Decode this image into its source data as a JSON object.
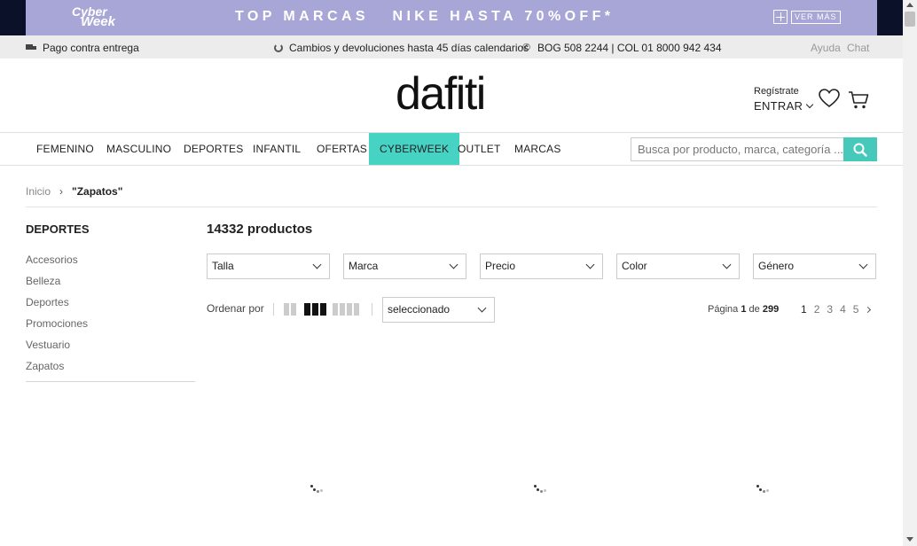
{
  "promo": {
    "logo_line1": "Cyber",
    "logo_line2": "Week",
    "text": "TOP MARCAS   NIKE HASTA 70%OFF*",
    "cta": "VER MÁS"
  },
  "utility": {
    "delivery": "Pago contra entrega",
    "returns": "Cambios y devoluciones hasta 45 días calendarios",
    "phones": "BOG 508 2244 | COL 01 8000 942 434",
    "help": "Ayuda",
    "chat": "Chat"
  },
  "header": {
    "logo": "dafiti",
    "register": "Regístrate",
    "login": "ENTRAR"
  },
  "nav": {
    "items": [
      "FEMENINO",
      "MASCULINO",
      "DEPORTES",
      "INFANTIL",
      "OFERTAS",
      "CYBERWEEK",
      "OUTLET",
      "MARCAS"
    ],
    "active": "CYBERWEEK",
    "search_placeholder": "Busca por producto, marca, categoría ..."
  },
  "breadcrumb": {
    "home": "Inicio",
    "separator": "›",
    "current": "\"Zapatos\""
  },
  "sidebar": {
    "title": "DEPORTES",
    "items": [
      "Accesorios",
      "Belleza",
      "Deportes",
      "Promociones",
      "Vestuario",
      "Zapatos"
    ]
  },
  "results": {
    "count": "14332 productos",
    "filters": [
      "Talla",
      "Marca",
      "Precio",
      "Color",
      "Género"
    ],
    "sort_label": "Ordenar por",
    "sort_value": "seleccionado",
    "page_prefix": "Página",
    "page_current": "1",
    "page_of": "de",
    "page_total": "299",
    "pages": [
      "1",
      "2",
      "3",
      "4",
      "5"
    ]
  },
  "colors": {
    "promo_bg": "#a8a6d6",
    "accent": "#46d3c4",
    "search_button": "#46c9ba"
  }
}
